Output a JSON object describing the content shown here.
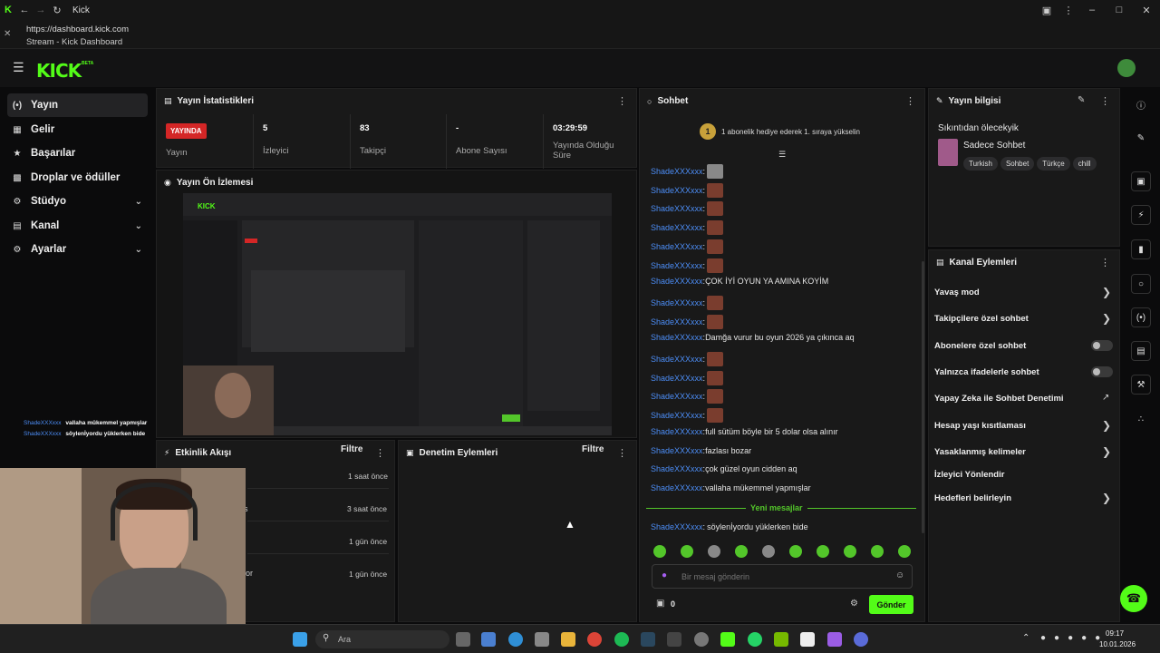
{
  "browser": {
    "tab_title": "Kick",
    "url": "https://dashboard.kick.com",
    "page_title": "Stream - Kick Dashboard"
  },
  "kick": {
    "logo_text": "KICK",
    "logo_badge": "BETA"
  },
  "sidebar": {
    "items": [
      {
        "label": "Yayın",
        "icon": "broadcast-icon"
      },
      {
        "label": "Gelir",
        "icon": "grid-icon"
      },
      {
        "label": "Başarılar",
        "icon": "trophy-icon"
      },
      {
        "label": "Droplar ve ödüller",
        "icon": "gift-icon"
      },
      {
        "label": "Stüdyo",
        "icon": "gear-icon"
      },
      {
        "label": "Kanal",
        "icon": "tv-icon"
      },
      {
        "label": "Ayarlar",
        "icon": "settings-icon"
      }
    ]
  },
  "stats": {
    "title": "Yayın İstatistikleri",
    "live_badge": "YAYINDA",
    "cells": [
      {
        "value": "",
        "label": "Yayın"
      },
      {
        "value": "5",
        "label": "İzleyici"
      },
      {
        "value": "83",
        "label": "Takipçi"
      },
      {
        "value": "-",
        "label": "Abone Sayısı"
      },
      {
        "value": "03:29:59",
        "label": "Yayında Olduğu Süre"
      }
    ]
  },
  "preview": {
    "title": "Yayın Ön İzlemesi"
  },
  "activity": {
    "title": "Etkinlik Akışı",
    "filter": "Filtre",
    "items": [
      {
        "time": "1 saat önce"
      },
      {
        "time": "3 saat önce"
      },
      {
        "time": "1 gün önce"
      },
      {
        "time": "1 gün önce"
      }
    ],
    "partial_texts": [
      "s",
      "or"
    ]
  },
  "moderation": {
    "title": "Denetim Eylemleri",
    "filter": "Filtre"
  },
  "overlay_chat": [
    {
      "user": "ShadeXXXxxx",
      "text": "vallaha mükemmel yapmışlar"
    },
    {
      "user": "ShadeXXXxxx",
      "text": "söylenİyordu yüklerken bide"
    }
  ],
  "chat": {
    "title": "Sohbet",
    "sub_goal_count": "1",
    "sub_goal_text": "1 abonelik hediye ederek 1. sıraya yükselin",
    "messages": [
      {
        "user": "ShadeXXXxxx",
        "text": "",
        "emote": "gray"
      },
      {
        "user": "ShadeXXXxxx",
        "text": "",
        "emote": "red"
      },
      {
        "user": "ShadeXXXxxx",
        "text": "",
        "emote": "red"
      },
      {
        "user": "ShadeXXXxxx",
        "text": "",
        "emote": "red"
      },
      {
        "user": "ShadeXXXxxx",
        "text": "",
        "emote": "red"
      },
      {
        "user": "ShadeXXXxxx",
        "text": "",
        "emote": "red"
      },
      {
        "user": "ShadeXXXxxx",
        "text": "ÇOK İYİ OYUN YA AMINA KOYİM",
        "emote": ""
      },
      {
        "user": "ShadeXXXxxx",
        "text": "",
        "emote": "red"
      },
      {
        "user": "ShadeXXXxxx",
        "text": "",
        "emote": "red"
      },
      {
        "user": "ShadeXXXxxx",
        "text": "Damğa vurur bu oyun 2026 ya çıkınca aq",
        "emote": ""
      },
      {
        "user": "ShadeXXXxxx",
        "text": "",
        "emote": "red"
      },
      {
        "user": "ShadeXXXxxx",
        "text": "",
        "emote": "red"
      },
      {
        "user": "ShadeXXXxxx",
        "text": "",
        "emote": "red"
      },
      {
        "user": "ShadeXXXxxx",
        "text": "",
        "emote": "red"
      },
      {
        "user": "ShadeXXXxxx",
        "text": "full sütüm böyle bir 5 dolar olsa alınır",
        "emote": ""
      },
      {
        "user": "ShadeXXXxxx",
        "text": "fazlası bozar",
        "emote": ""
      },
      {
        "user": "ShadeXXXxxx",
        "text": "çok güzel oyun cidden aq",
        "emote": ""
      },
      {
        "user": "ShadeXXXxxx",
        "text": "vallaha mükemmel yapmışlar",
        "emote": ""
      }
    ],
    "new_messages_divider": "Yeni mesajlar",
    "last_message": {
      "user": "ShadeXXXxxx",
      "text": "söylenİyordu yüklerken bide"
    },
    "input_placeholder": "Bir mesaj gönderin",
    "points": "0",
    "send_label": "Gönder"
  },
  "stream_info": {
    "title": "Yayın bilgisi",
    "stream_title": "Sıkıntıdan ölecekyik",
    "category": "Sadece Sohbet",
    "tags": [
      "Turkish",
      "Sohbet",
      "Türkçe",
      "chill"
    ]
  },
  "channel_actions": {
    "title": "Kanal Eylemleri",
    "items": [
      {
        "label": "Yavaş mod",
        "control": "chevron"
      },
      {
        "label": "Takipçilere özel sohbet",
        "control": "chevron"
      },
      {
        "label": "Abonelere özel sohbet",
        "control": "toggle"
      },
      {
        "label": "Yalnızca ifadelerle sohbet",
        "control": "toggle"
      },
      {
        "label": "Yapay Zeka ile Sohbet Denetimi",
        "control": "external"
      },
      {
        "label": "Hesap yaşı kısıtlaması",
        "control": "chevron"
      },
      {
        "label": "Yasaklanmış kelimeler",
        "control": "chevron"
      },
      {
        "label": "İzleyici Yönlendir",
        "control": "none"
      },
      {
        "label": "Hedefleri belirleyin",
        "control": "chevron"
      }
    ]
  },
  "taskbar": {
    "search_placeholder": "Ara",
    "time": "09:17",
    "date": "10.01.2026"
  },
  "colors": {
    "brand": "#53fc18",
    "live": "#d42626",
    "username": "#4c8df6",
    "panel": "#191919"
  }
}
